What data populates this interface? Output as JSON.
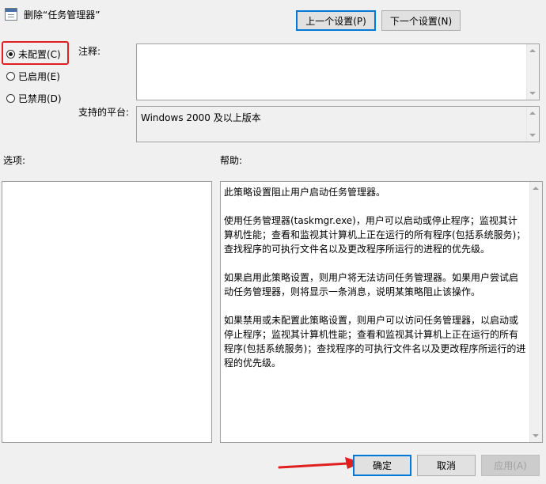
{
  "window": {
    "title": "删除“任务管理器”"
  },
  "nav": {
    "prev_label": "上一个设置(P)",
    "next_label": "下一个设置(N)"
  },
  "state_options": [
    {
      "label": "未配置(C)",
      "checked": true
    },
    {
      "label": "已启用(E)",
      "checked": false
    },
    {
      "label": "已禁用(D)",
      "checked": false
    }
  ],
  "comment": {
    "label": "注释:",
    "value": ""
  },
  "platform": {
    "label": "支持的平台:",
    "value": "Windows 2000 及以上版本"
  },
  "options": {
    "label": "选项:"
  },
  "help": {
    "label": "帮助:",
    "paragraphs": [
      "此策略设置阻止用户启动任务管理器。",
      "使用任务管理器(taskmgr.exe)，用户可以启动或停止程序；监视其计算机性能；查看和监视其计算机上正在运行的所有程序(包括系统服务)；查找程序的可执行文件名以及更改程序所运行的进程的优先级。",
      "如果启用此策略设置，则用户将无法访问任务管理器。如果用户尝试启动任务管理器，则将显示一条消息，说明某策略阻止该操作。",
      "如果禁用或未配置此策略设置，则用户可以访问任务管理器，以启动或停止程序；监视其计算机性能；查看和监视其计算机上正在运行的所有程序(包括系统服务)；查找程序的可执行文件名以及更改程序所运行的进程的优先级。"
    ]
  },
  "footer": {
    "ok_label": "确定",
    "cancel_label": "取消",
    "apply_label": "应用(A)"
  },
  "colors": {
    "highlight": "#e02020",
    "arrow": "#e02020",
    "accent": "#0078d7"
  }
}
